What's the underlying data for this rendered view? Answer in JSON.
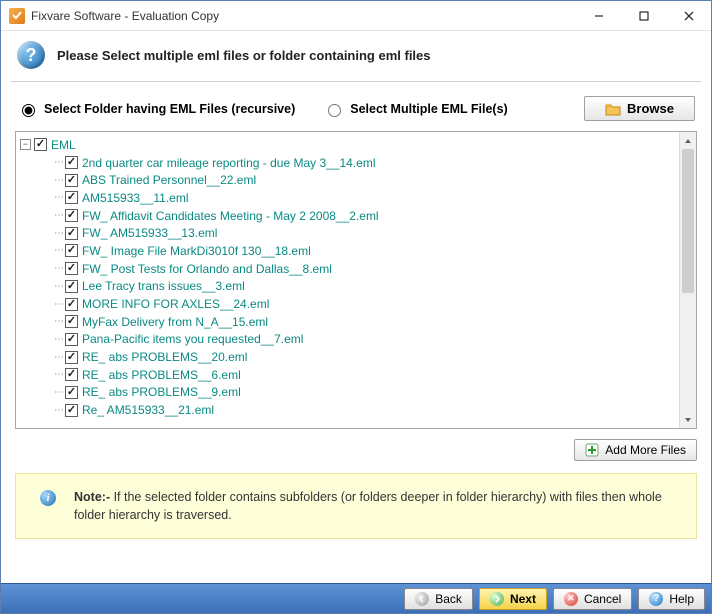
{
  "window": {
    "title": "Fixvare Software - Evaluation Copy"
  },
  "header": {
    "instruction": "Please Select multiple eml files or folder containing eml files"
  },
  "options": {
    "folder_label": "Select Folder having EML Files (recursive)",
    "files_label": "Select Multiple EML File(s)"
  },
  "buttons": {
    "browse": "Browse",
    "add_more_files": "Add More Files"
  },
  "tree": {
    "root_label": "EML",
    "items": [
      "2nd quarter car mileage reporting - due May 3__14.eml",
      "ABS Trained Personnel__22.eml",
      "AM515933__11.eml",
      "FW_ Affidavit Candidates Meeting - May 2 2008__2.eml",
      "FW_ AM515933__13.eml",
      "FW_ Image File MarkDi3010f 130__18.eml",
      "FW_ Post Tests for Orlando and Dallas__8.eml",
      "Lee Tracy trans issues__3.eml",
      "MORE INFO FOR AXLES__24.eml",
      "MyFax Delivery from N_A__15.eml",
      "Pana-Pacific items you requested__7.eml",
      "RE_ abs PROBLEMS__20.eml",
      "RE_ abs PROBLEMS__6.eml",
      "RE_ abs PROBLEMS__9.eml",
      "Re_ AM515933__21.eml"
    ]
  },
  "note": {
    "prefix": "Note:- ",
    "body": "If the selected folder contains subfolders (or folders deeper in folder hierarchy) with files then whole folder hierarchy is traversed."
  },
  "footer": {
    "back": "Back",
    "next": "Next",
    "cancel": "Cancel",
    "help": "Help"
  }
}
